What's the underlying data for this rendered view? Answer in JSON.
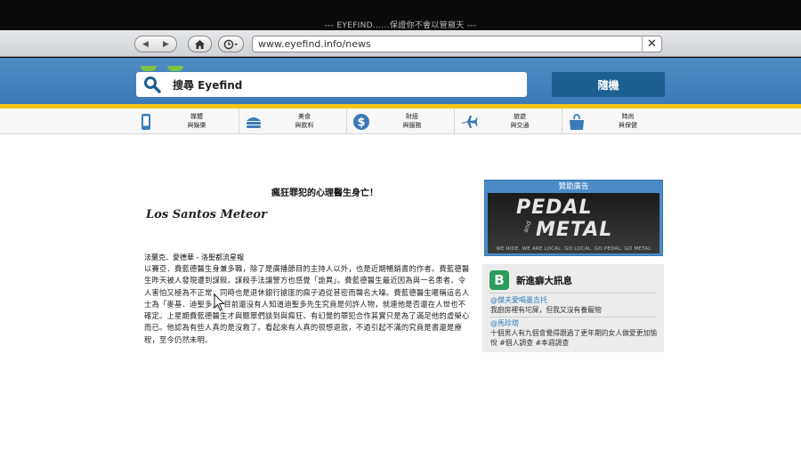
{
  "window": {
    "title": "--- EYEFIND......保證你不會以管窺天 ---"
  },
  "browser": {
    "back_glyph": "◀",
    "forward_glyph": "▶",
    "home_icon": "home-icon",
    "history_icon": "clock-icon",
    "url": "www.eyefind.info/news",
    "close_glyph": "✕"
  },
  "header": {
    "search_placeholder": "搜尋 Eyefind",
    "random_button": "隨機"
  },
  "categories": [
    {
      "line1": "媒體",
      "line2": "與娛樂",
      "icon": "phone-icon"
    },
    {
      "line1": "美食",
      "line2": "與飲料",
      "icon": "food-icon"
    },
    {
      "line1": "財經",
      "line2": "與服務",
      "icon": "dollar-icon"
    },
    {
      "line1": "旅遊",
      "line2": "與交通",
      "icon": "plane-icon"
    },
    {
      "line1": "時尚",
      "line2": "與保健",
      "icon": "bag-icon"
    }
  ],
  "article": {
    "title": "瘋狂罪犯的心理醫生身亡！",
    "image_brand": "Los Santos Meteor",
    "byline": "法蘭克．愛德華 - 洛聖都流星報",
    "body": "以賽亞．費藍德醫生身兼多職，除了是廣播節目的主持人以外，也是近期暢銷書的作者。費藍德醫生昨天被人發現遭到謀殺。謀殺手法讓警方也感覺「詭異」。費藍德醫生最近因為與一名患者、令人害怕又極為不正常，同時也是退休銀行搶匪的瘋子過從甚密而聲名大噪。費藍德醫生暱稱這名人士為「麥基．迪聖多」。目前還沒有人知道迪聖多先生究竟是何許人物，就連他是否還在人世也不確定。上星期費藍德醫生才與聽眾們談到與瘋狂、有幻覺的罪犯合作其實只是為了滿足他的虛榮心而已。他認為有些人真的是沒救了。看起來有人真的很想退款，不過引起不滿的究竟是書還是療程，至今仍然未明。"
  },
  "sponsored": {
    "heading": "贊助廣告",
    "ad_line1": "PEDAL",
    "ad_and": "and",
    "ad_line2": "METAL",
    "ad_tagline": "WE RIDE. WE ARE LOCAL. GO LOCAL. GO PEDAL. GO METAL"
  },
  "bleeter": {
    "logo": "B",
    "title": "新進癖大訊息",
    "posts": [
      {
        "user": "@傑夫愛喝墨吉托",
        "text": "我廚房裡有坨屎，但我又沒有養寵物"
      },
      {
        "user": "@馬珍塔",
        "text": "十個男人有九個會覺得跟過了更年期的女人做愛更加愉悅 #個人調查 #本週調查"
      }
    ]
  },
  "colors": {
    "header_blue": "#3b7ab7",
    "accent_yellow": "#f5c518",
    "button_blue": "#1c5f92",
    "bleeter_green": "#2a9d5a"
  }
}
